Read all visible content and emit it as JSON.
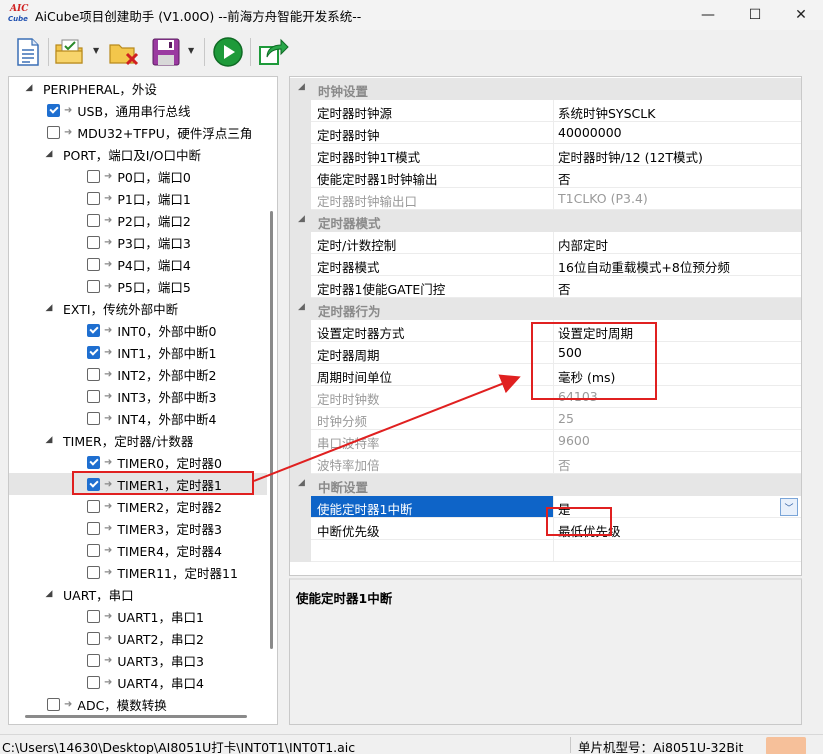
{
  "window": {
    "title": "AiCube项目创建助手 (V1.00O) --前海方舟智能开发系统--",
    "app_icon_top": "AIC",
    "app_icon_bottom": "Cube",
    "minimize_symbol": "—",
    "maximize_symbol": "☐",
    "close_symbol": "✕"
  },
  "toolbar": {
    "buttons": [
      "new-document-icon",
      "open-project-icon",
      "close-project-icon",
      "save-icon",
      "run-icon",
      "export-icon"
    ],
    "dropdown_symbol": "▼"
  },
  "tree": {
    "items": [
      {
        "label": "PERIPHERAL，外设",
        "level": 0,
        "toggle": "◢",
        "checkbox": null
      },
      {
        "label": "USB，通用串行总线",
        "level": 1,
        "toggle": "",
        "checkbox": "checked"
      },
      {
        "label": "MDU32+TFPU，硬件浮点三角",
        "level": 1,
        "toggle": "",
        "checkbox": "unchecked"
      },
      {
        "label": "PORT，端口及I/O口中断",
        "level": 1,
        "toggle": "◢",
        "checkbox": null
      },
      {
        "label": "P0口，端口0",
        "level": 2,
        "toggle": "",
        "checkbox": "unchecked"
      },
      {
        "label": "P1口，端口1",
        "level": 2,
        "toggle": "",
        "checkbox": "unchecked"
      },
      {
        "label": "P2口，端口2",
        "level": 2,
        "toggle": "",
        "checkbox": "unchecked"
      },
      {
        "label": "P3口，端口3",
        "level": 2,
        "toggle": "",
        "checkbox": "unchecked"
      },
      {
        "label": "P4口，端口4",
        "level": 2,
        "toggle": "",
        "checkbox": "unchecked"
      },
      {
        "label": "P5口，端口5",
        "level": 2,
        "toggle": "",
        "checkbox": "unchecked"
      },
      {
        "label": "EXTI，传统外部中断",
        "level": 1,
        "toggle": "◢",
        "checkbox": null
      },
      {
        "label": "INT0，外部中断0",
        "level": 2,
        "toggle": "",
        "checkbox": "checked"
      },
      {
        "label": "INT1，外部中断1",
        "level": 2,
        "toggle": "",
        "checkbox": "checked"
      },
      {
        "label": "INT2，外部中断2",
        "level": 2,
        "toggle": "",
        "checkbox": "unchecked"
      },
      {
        "label": "INT3，外部中断3",
        "level": 2,
        "toggle": "",
        "checkbox": "unchecked"
      },
      {
        "label": "INT4，外部中断4",
        "level": 2,
        "toggle": "",
        "checkbox": "unchecked"
      },
      {
        "label": "TIMER，定时器/计数器",
        "level": 1,
        "toggle": "◢",
        "checkbox": null
      },
      {
        "label": "TIMER0，定时器0",
        "level": 2,
        "toggle": "",
        "checkbox": "checked"
      },
      {
        "label": "TIMER1，定时器1",
        "level": 2,
        "toggle": "",
        "checkbox": "checked",
        "selected": true
      },
      {
        "label": "TIMER2，定时器2",
        "level": 2,
        "toggle": "",
        "checkbox": "unchecked"
      },
      {
        "label": "TIMER3，定时器3",
        "level": 2,
        "toggle": "",
        "checkbox": "unchecked"
      },
      {
        "label": "TIMER4，定时器4",
        "level": 2,
        "toggle": "",
        "checkbox": "unchecked"
      },
      {
        "label": "TIMER11，定时器11",
        "level": 2,
        "toggle": "",
        "checkbox": "unchecked"
      },
      {
        "label": "UART，串口",
        "level": 1,
        "toggle": "◢",
        "checkbox": null
      },
      {
        "label": "UART1，串口1",
        "level": 2,
        "toggle": "",
        "checkbox": "unchecked"
      },
      {
        "label": "UART2，串口2",
        "level": 2,
        "toggle": "",
        "checkbox": "unchecked"
      },
      {
        "label": "UART3，串口3",
        "level": 2,
        "toggle": "",
        "checkbox": "unchecked"
      },
      {
        "label": "UART4，串口4",
        "level": 2,
        "toggle": "",
        "checkbox": "unchecked"
      },
      {
        "label": "ADC，模数转换",
        "level": 1,
        "toggle": "",
        "checkbox": "unchecked"
      }
    ],
    "arrow_symbol": "➜"
  },
  "property_grid": {
    "collapse_symbol": "◢",
    "dropdown_symbol": "﹀",
    "rows": [
      {
        "type": "category",
        "label": "时钟设置"
      },
      {
        "type": "prop",
        "name": "定时器时钟源",
        "value": "系统时钟SYSCLK"
      },
      {
        "type": "prop",
        "name": "定时器时钟",
        "value": "40000000"
      },
      {
        "type": "prop",
        "name": "定时器时钟1T模式",
        "value": "定时器时钟/12 (12T模式)"
      },
      {
        "type": "prop",
        "name": "使能定时器1时钟输出",
        "value": "否"
      },
      {
        "type": "prop",
        "name": "定时器时钟输出口",
        "value": "T1CLKO (P3.4)",
        "readonly": true
      },
      {
        "type": "category",
        "label": "定时器模式"
      },
      {
        "type": "prop",
        "name": "定时/计数控制",
        "value": "内部定时"
      },
      {
        "type": "prop",
        "name": "定时器模式",
        "value": "16位自动重载模式+8位预分频"
      },
      {
        "type": "prop",
        "name": "定时器1使能GATE门控",
        "value": "否"
      },
      {
        "type": "category",
        "label": "定时器行为"
      },
      {
        "type": "prop",
        "name": "设置定时器方式",
        "value": "设置定时周期"
      },
      {
        "type": "prop",
        "name": "定时器周期",
        "value": "500"
      },
      {
        "type": "prop",
        "name": "周期时间单位",
        "value": "毫秒 (ms)"
      },
      {
        "type": "prop",
        "name": "定时时钟数",
        "value": "64103",
        "readonly": true
      },
      {
        "type": "prop",
        "name": "时钟分频",
        "value": "25",
        "readonly": true
      },
      {
        "type": "prop",
        "name": "串口波特率",
        "value": "9600",
        "readonly": true
      },
      {
        "type": "prop",
        "name": "波特率加倍",
        "value": "否",
        "readonly": true
      },
      {
        "type": "category",
        "label": "中断设置"
      },
      {
        "type": "prop",
        "name": "使能定时器1中断",
        "value": "是",
        "selected": true
      },
      {
        "type": "prop",
        "name": "中断优先级",
        "value": "最低优先级"
      },
      {
        "type": "prop",
        "name": "",
        "value": ""
      }
    ]
  },
  "description": {
    "text": "使能定时器1中断"
  },
  "statusbar": {
    "path": "C:\\Users\\14630\\Desktop\\AI8051U打卡\\INT0T1\\INT0T1.aic",
    "mcu": "单片机型号：Ai8051U-32Bit"
  },
  "colors": {
    "annotation_red": "#e02020",
    "selection_blue": "#0e64c8",
    "checkbox_blue": "#1f6fd0"
  }
}
